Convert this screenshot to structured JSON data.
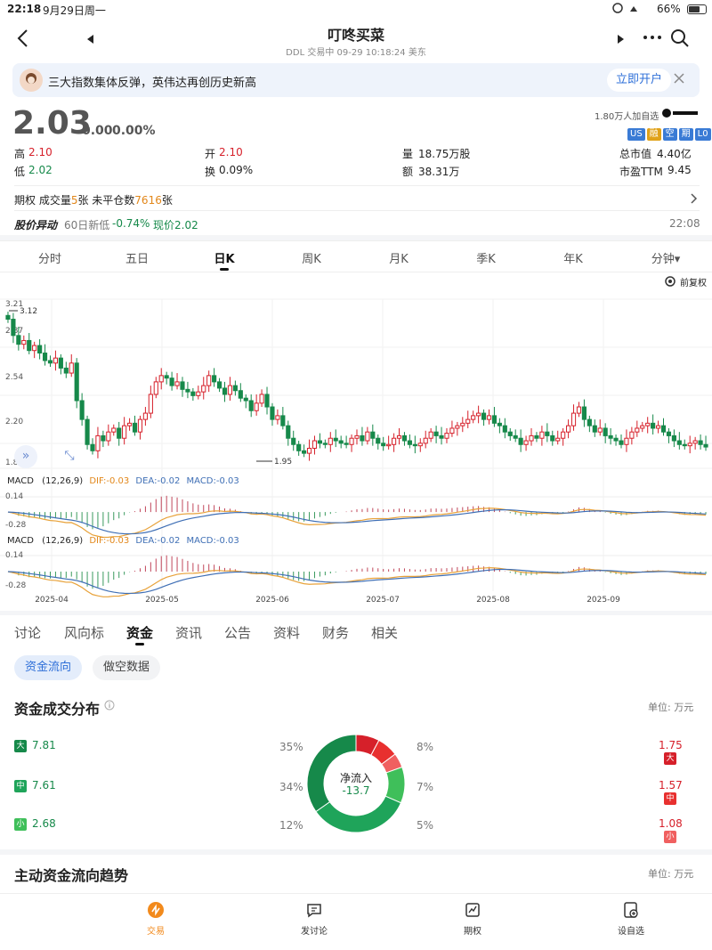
{
  "status": {
    "time": "22:18",
    "date": "9月29日周一",
    "battery": "66%"
  },
  "nav": {
    "title": "叮咚买菜",
    "subtitle": "DDL 交易中 09-29 10:18:24 美东"
  },
  "banner": {
    "text": "三大指数集体反弹，英伟达再创历史新高",
    "button": "立即开户"
  },
  "quote": {
    "price": "2.03",
    "change": "0.00",
    "change_pct": "0.00%",
    "followers": "1.80万人加自选",
    "tags": [
      "US",
      "融",
      "空",
      "期",
      "L0"
    ],
    "stats": [
      {
        "label": "高",
        "value": "2.10",
        "color": "red"
      },
      {
        "label": "开",
        "value": "2.10",
        "color": "red"
      },
      {
        "label": "量",
        "value": "18.75万股",
        "color": "plain"
      },
      {
        "label": "总市值",
        "value": "4.40亿",
        "color": "plain"
      },
      {
        "label": "低",
        "value": "2.02",
        "color": "green"
      },
      {
        "label": "换",
        "value": "0.09%",
        "color": "plain"
      },
      {
        "label": "额",
        "value": "38.31万",
        "color": "plain"
      },
      {
        "label": "市盈TTM",
        "value": "9.45",
        "color": "plain"
      }
    ],
    "options_prefix": "期权 成交量",
    "options_volume": "5",
    "options_mid": "张 未平仓数",
    "options_oi": "7616",
    "options_suffix": "张",
    "alert_title": "股价异动",
    "alert_text": "60日新低",
    "alert_change": "-0.74%",
    "alert_price": "现价2.02",
    "alert_time": "22:08"
  },
  "period_tabs": [
    "分时",
    "五日",
    "日K",
    "周K",
    "月K",
    "季K",
    "年K",
    "分钟▾"
  ],
  "chart_toolbar": {
    "adjust": "前复权"
  },
  "chart_data": {
    "type": "candlestick",
    "y_ticks": [
      "3.21",
      "2.87",
      "2.54",
      "2.20",
      "1.86"
    ],
    "ylim": [
      1.86,
      3.21
    ],
    "annotations": {
      "high": "3.12",
      "low": "1.95"
    },
    "x_ticks": [
      "2025-04",
      "2025-05",
      "2025-06",
      "2025-07",
      "2025-08",
      "2025-09"
    ],
    "closes": [
      3.05,
      2.92,
      2.85,
      2.88,
      2.8,
      2.84,
      2.78,
      2.72,
      2.7,
      2.74,
      2.66,
      2.62,
      2.7,
      2.4,
      2.25,
      2.05,
      2.0,
      2.12,
      2.08,
      2.15,
      2.18,
      2.1,
      2.2,
      2.22,
      2.15,
      2.25,
      2.3,
      2.45,
      2.55,
      2.6,
      2.58,
      2.52,
      2.55,
      2.49,
      2.47,
      2.44,
      2.47,
      2.52,
      2.6,
      2.55,
      2.5,
      2.45,
      2.52,
      2.48,
      2.42,
      2.4,
      2.32,
      2.38,
      2.45,
      2.35,
      2.25,
      2.28,
      2.2,
      2.1,
      2.05,
      2.0,
      1.98,
      2.02,
      2.08,
      2.06,
      2.05,
      2.1,
      2.08,
      2.06,
      2.05,
      2.1,
      2.12,
      2.08,
      2.15,
      2.1,
      2.06,
      2.04,
      2.05,
      2.1,
      2.12,
      2.08,
      2.05,
      2.04,
      2.06,
      2.1,
      2.15,
      2.12,
      2.1,
      2.14,
      2.18,
      2.2,
      2.22,
      2.25,
      2.28,
      2.3,
      2.25,
      2.28,
      2.22,
      2.2,
      2.15,
      2.12,
      2.1,
      2.05,
      2.08,
      2.12,
      2.1,
      2.15,
      2.12,
      2.08,
      2.1,
      2.15,
      2.2,
      2.3,
      2.35,
      2.25,
      2.2,
      2.15,
      2.18,
      2.12,
      2.1,
      2.08,
      2.05,
      2.1,
      2.15,
      2.18,
      2.2,
      2.22,
      2.18,
      2.2,
      2.15,
      2.12,
      2.08,
      2.05,
      2.04,
      2.06,
      2.08,
      2.05,
      2.03
    ],
    "macd_ticks": [
      "0.14",
      "-0.28"
    ],
    "macd_label": "MACD",
    "macd_params": "(12,26,9)",
    "dif": "DIF:-0.03",
    "dea": "DEA:-0.02",
    "macd": "MACD:-0.03",
    "colors": {
      "up": "#d6202a",
      "down": "#16894a",
      "dif": "#e8a23a",
      "dea": "#3f6fb5"
    }
  },
  "section_tabs": [
    "讨论",
    "风向标",
    "资金",
    "资讯",
    "公告",
    "资料",
    "财务",
    "相关"
  ],
  "sub_tabs": [
    "资金流向",
    "做空数据"
  ],
  "flow": {
    "title": "资金成交分布",
    "unit": "单位: 万元",
    "center_label": "净流入",
    "center_value": "-13.7",
    "rows": [
      {
        "label": "大",
        "out": "7.81",
        "out_pct": "35%",
        "in_pct": "8%",
        "in": "1.75"
      },
      {
        "label": "中",
        "out": "7.61",
        "out_pct": "34%",
        "in_pct": "7%",
        "in": "1.57"
      },
      {
        "label": "小",
        "out": "2.68",
        "out_pct": "12%",
        "in_pct": "5%",
        "in": "1.08"
      }
    ]
  },
  "trend": {
    "title": "主动资金流向趋势",
    "unit": "单位: 万元"
  },
  "bottom_nav": [
    "交易",
    "发讨论",
    "期权",
    "设自选"
  ]
}
